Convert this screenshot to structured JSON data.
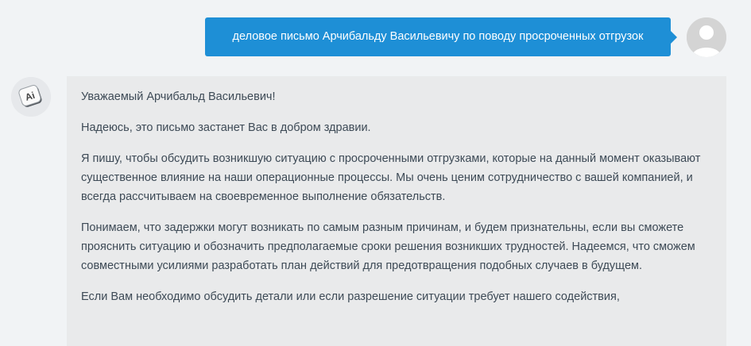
{
  "user_message": {
    "text": "деловое письмо Арчибальду Васильевичу по поводу просроченных отгрузок",
    "avatar_icon": "user-avatar-icon",
    "bubble_color": "#1e8fd6"
  },
  "ai_message": {
    "avatar_icon": "ai-avatar-icon",
    "avatar_label": "Ai",
    "paragraphs": [
      "Уважаемый Арчибальд Васильевич!",
      "Надеюсь, это письмо застанет Вас в добром здравии.",
      "Я пишу, чтобы обсудить возникшую ситуацию с просроченными отгрузками, которые на данный момент оказывают существенное влияние на наши операционные процессы. Мы очень ценим сотрудничество с вашей компанией, и всегда рассчитываем на своевременное выполнение обязательств.",
      "Понимаем, что задержки могут возникать по самым разным причинам, и будем признательны, если вы сможете прояснить ситуацию и обозначить предполагаемые сроки решения возникших трудностей. Надеемся, что сможем совместными усилиями разработать план действий для предотвращения подобных случаев в будущем.",
      "Если Вам необходимо обсудить детали или если разрешение ситуации требует нашего содействия,"
    ]
  }
}
